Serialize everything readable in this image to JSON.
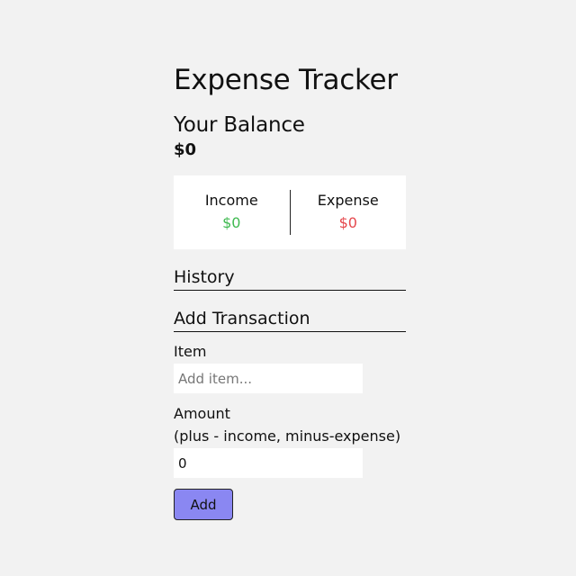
{
  "app": {
    "title": "Expense Tracker"
  },
  "balance": {
    "heading": "Your Balance",
    "value": "$0"
  },
  "summary": {
    "income_label": "Income",
    "income_value": "$0",
    "expense_label": "Expense",
    "expense_value": "$0",
    "income_color": "#3fb950",
    "expense_color": "#e5484d"
  },
  "history": {
    "heading": "History"
  },
  "add_transaction": {
    "heading": "Add Transaction",
    "item_label": "Item",
    "item_placeholder": "Add item...",
    "item_value": "",
    "amount_label": "Amount",
    "amount_hint": "(plus - income, minus-expense)",
    "amount_value": "0",
    "submit_label": "Add",
    "submit_color": "#8a87f2"
  }
}
